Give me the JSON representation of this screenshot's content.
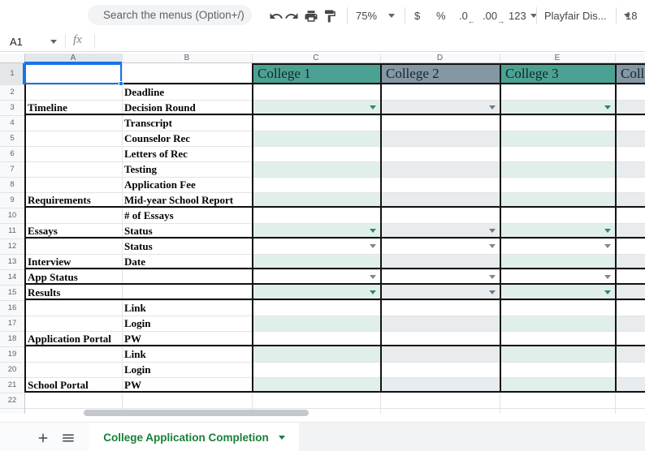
{
  "toolbar": {
    "search_placeholder": "Search the menus (Option+/)",
    "zoom_level": "75%",
    "currency_label": "$",
    "percent_label": "%",
    "decrease_decimal_label": ".0",
    "increase_decimal_label": ".00",
    "more_formats_label": "123",
    "font_family_label": "Playfair Dis...",
    "font_size_label": "18",
    "icons": {
      "undo": "undo-curved-arrow",
      "redo": "redo-curved-arrow",
      "print": "printer",
      "paint_format": "paint-roller"
    }
  },
  "formula_bar": {
    "name_box_value": "A1",
    "fx_label": "fx"
  },
  "sheet": {
    "selected_cell": "A1",
    "column_letters": [
      "A",
      "B",
      "C",
      "D",
      "E"
    ],
    "row_numbers": [
      1,
      2,
      3,
      4,
      5,
      6,
      7,
      8,
      9,
      10,
      11,
      12,
      13,
      14,
      15,
      16,
      17,
      18,
      19,
      20,
      21,
      22
    ],
    "college_headers": [
      {
        "label": "College 1",
        "bg": "#4ba292",
        "tint": "#e1efeb"
      },
      {
        "label": "College 2",
        "bg": "#8497a4",
        "tint": "#e8ecef"
      },
      {
        "label": "College 3",
        "bg": "#4ba292",
        "tint": "#e1efeb"
      },
      {
        "label": "Coll",
        "bg": "#8497a4",
        "tint": "#e8ecef"
      }
    ],
    "rows": [
      {
        "n": 2,
        "a": "",
        "b": "Deadline",
        "dropdown": false
      },
      {
        "n": 3,
        "a": "Timeline",
        "b": "Decision Round",
        "dropdown": true
      },
      {
        "n": 4,
        "a": "",
        "b": "Transcript",
        "dropdown": false
      },
      {
        "n": 5,
        "a": "",
        "b": "Counselor Rec",
        "dropdown": false
      },
      {
        "n": 6,
        "a": "",
        "b": "Letters of Rec",
        "dropdown": false
      },
      {
        "n": 7,
        "a": "",
        "b": "Testing",
        "dropdown": false
      },
      {
        "n": 8,
        "a": "",
        "b": "Application Fee",
        "dropdown": false
      },
      {
        "n": 9,
        "a": "Requirements",
        "b": "Mid-year School Report",
        "dropdown": false
      },
      {
        "n": 10,
        "a": "",
        "b": "# of Essays",
        "dropdown": false
      },
      {
        "n": 11,
        "a": "Essays",
        "b": "Status",
        "dropdown": true
      },
      {
        "n": 12,
        "a": "",
        "b": "Status",
        "dropdown": true
      },
      {
        "n": 13,
        "a": "Interview",
        "b": "Date",
        "dropdown": false
      },
      {
        "n": 14,
        "a": "App Status",
        "b": "",
        "dropdown": true
      },
      {
        "n": 15,
        "a": "Results",
        "b": "",
        "dropdown": true
      },
      {
        "n": 16,
        "a": "",
        "b": "Link",
        "dropdown": false
      },
      {
        "n": 17,
        "a": "",
        "b": "Login",
        "dropdown": false
      },
      {
        "n": 18,
        "a": "Application Portal",
        "b": "PW",
        "dropdown": false
      },
      {
        "n": 19,
        "a": "",
        "b": "Link",
        "dropdown": false
      },
      {
        "n": 20,
        "a": "",
        "b": "Login",
        "dropdown": false
      },
      {
        "n": 21,
        "a": "School Portal",
        "b": "PW",
        "dropdown": false
      },
      {
        "n": 22,
        "a": "",
        "b": "",
        "dropdown": false
      }
    ],
    "tinted_rows": [
      3,
      5,
      7,
      9,
      11,
      13,
      15,
      17,
      19,
      21
    ],
    "section_end_rows": [
      3,
      9,
      11,
      13,
      14,
      15,
      18,
      21
    ],
    "colors": {
      "selection_blue": "#1a73e8",
      "teal_arrow": "#2e8573",
      "slate_arrow": "#6e7a84",
      "gray_arrow": "#80868b",
      "border_black": "#141414",
      "gridline": "#e2e3e5",
      "header_bg": "#f8f9fa",
      "header_selected_bg": "#e3e7ea"
    }
  },
  "tab_bar": {
    "active_tab": "College Application Completion"
  }
}
